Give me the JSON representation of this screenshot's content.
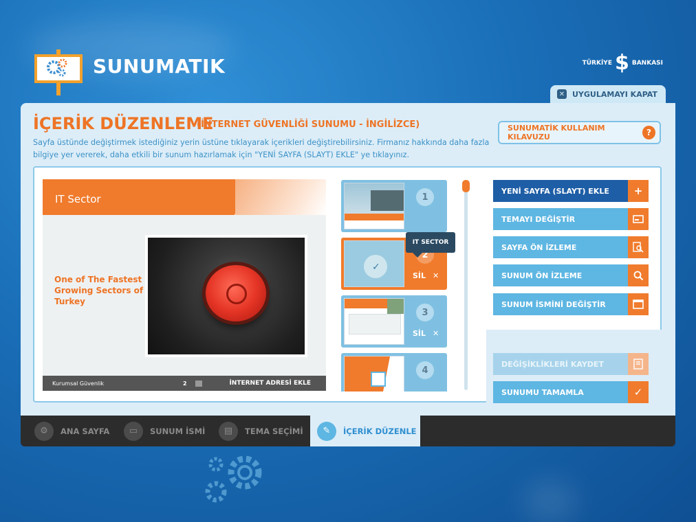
{
  "header": {
    "app_title": "SUNUMATIK",
    "bank_left": "TÜRKİYE",
    "bank_mark": "$",
    "bank_right": "BANKASI",
    "close_label": "UYGULAMAYI KAPAT"
  },
  "section": {
    "title": "İÇERİK DÜZENLEME",
    "subtitle": "(İNTERNET GÜVENLİĞİ SUNUMU - İNGİLİZCE)",
    "description": "Sayfa üstünde değiştirmek istediğiniz yerin üstüne tıklayarak içerikleri değiştirebilirsiniz. Firmanız hakkında daha fazla bilgiye yer vererek, daha etkili bir sunum hazırlamak için \"YENİ SAYFA (SLAYT) EKLE\" ye tıklayınız.",
    "guide_label": "SUNUMATİK KULLANIM KILAVUZU",
    "guide_icon": "?"
  },
  "slide": {
    "title": "IT Sector",
    "body_text": "One of The Fastest Growing Sectors of Turkey",
    "footer_left": "Kurumsal Güvenlik",
    "footer_page": "2",
    "footer_right": "İNTERNET ADRESİ EKLE"
  },
  "thumbnails": [
    {
      "number": "1"
    },
    {
      "number": "2",
      "delete_label": "SİL",
      "tooltip": "IT SECTOR",
      "active": true
    },
    {
      "number": "3",
      "delete_label": "SİL"
    },
    {
      "number": "4"
    }
  ],
  "actions": [
    {
      "label": "YENİ SAYFA (SLAYT) EKLE",
      "icon": "plus-icon"
    },
    {
      "label": "TEMAYI DEĞİŞTİR",
      "icon": "theme-icon"
    },
    {
      "label": "SAYFA ÖN İZLEME",
      "icon": "page-preview-icon"
    },
    {
      "label": "SUNUM ÖN İZLEME",
      "icon": "search-icon"
    },
    {
      "label": "SUNUM İSMİNİ DEĞİŞTİR",
      "icon": "window-icon"
    }
  ],
  "save_actions": [
    {
      "label": "DEĞİŞİKLİKLERİ KAYDET",
      "icon": "save-icon",
      "enabled": false
    },
    {
      "label": "SUNUMU TAMAMLA",
      "icon": "check-icon",
      "enabled": true
    }
  ],
  "nav": [
    {
      "label": "ANA SAYFA",
      "icon": "gear-icon"
    },
    {
      "label": "SUNUM İSMİ",
      "icon": "monitor-icon"
    },
    {
      "label": "TEMA SEÇİMİ",
      "icon": "card-icon"
    },
    {
      "label": "İÇERİK DÜZENLE",
      "icon": "pencil-icon",
      "active": true
    }
  ],
  "colors": {
    "accent_orange": "#f07b2c",
    "primary_blue": "#1e5ea6",
    "button_blue": "#5eb6e2",
    "panel": "#dcedf8"
  }
}
